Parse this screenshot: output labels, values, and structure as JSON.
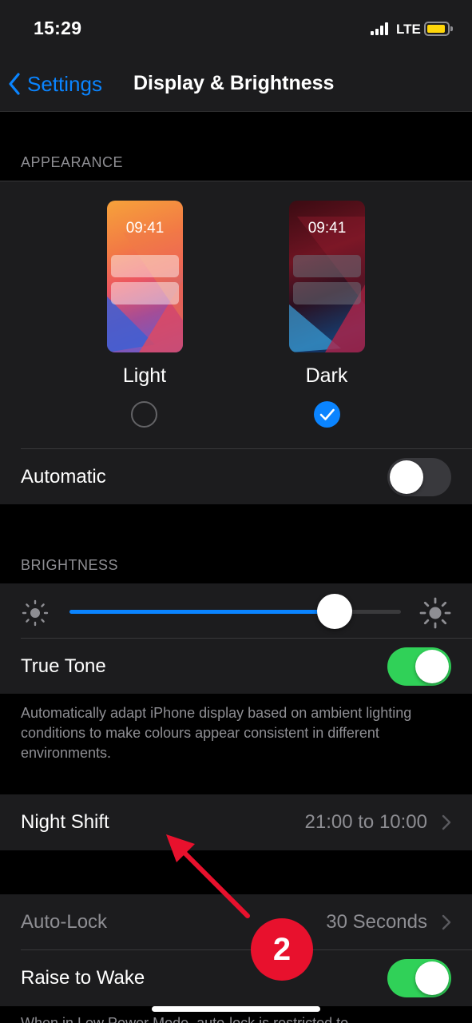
{
  "status_bar": {
    "time": "15:29",
    "network": "LTE",
    "battery_color": "#ffd60a"
  },
  "nav": {
    "back_label": "Settings",
    "title": "Display & Brightness"
  },
  "appearance": {
    "header": "APPEARANCE",
    "options": [
      {
        "label": "Light",
        "preview_time": "09:41",
        "selected": false
      },
      {
        "label": "Dark",
        "preview_time": "09:41",
        "selected": true
      }
    ],
    "automatic": {
      "label": "Automatic",
      "on": false
    }
  },
  "brightness": {
    "header": "BRIGHTNESS",
    "level": 0.8,
    "true_tone": {
      "label": "True Tone",
      "on": true
    },
    "true_tone_footnote": "Automatically adapt iPhone display based on ambient lighting conditions to make colours appear consistent in different environments."
  },
  "night_shift": {
    "label": "Night Shift",
    "value": "21:00 to 10:00"
  },
  "auto_lock": {
    "label": "Auto-Lock",
    "value": "30 Seconds"
  },
  "raise_to_wake": {
    "label": "Raise to Wake",
    "on": true
  },
  "footer_partial": "When in Low Power Mode, auto-lock is restricted to",
  "annotation": {
    "badge_number": "2",
    "color": "#e8112d"
  },
  "colors": {
    "accent": "#0a84ff",
    "toggle_on": "#30d158",
    "background": "#000000",
    "cell": "#1c1c1e"
  }
}
